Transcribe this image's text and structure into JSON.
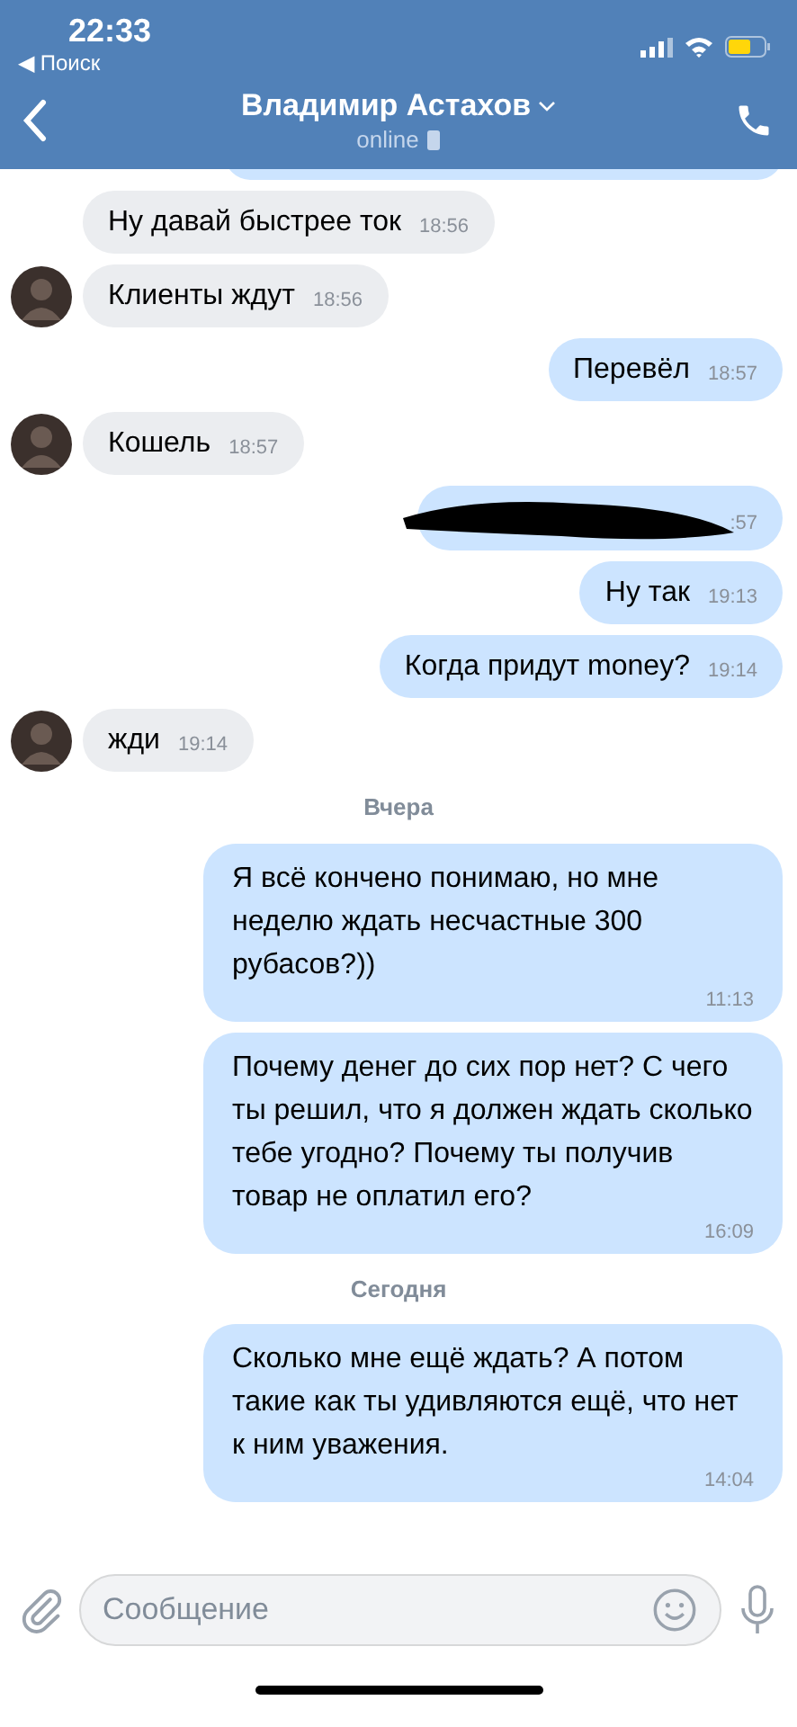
{
  "status_bar": {
    "time": "22:33",
    "back_label": "◀ Поиск"
  },
  "header": {
    "title": "Владимир Астахов",
    "status": "online"
  },
  "messages": [
    {
      "kind": "incoming",
      "avatar": false,
      "text": "Ну давай быстрее ток",
      "time": "18:56"
    },
    {
      "kind": "incoming",
      "avatar": true,
      "text": "Клиенты ждут",
      "time": "18:56"
    },
    {
      "kind": "outgoing",
      "text": "Перевёл",
      "time": "18:57"
    },
    {
      "kind": "incoming",
      "avatar": true,
      "text": "Кошель",
      "time": "18:57"
    },
    {
      "kind": "redacted",
      "time": ":57"
    },
    {
      "kind": "outgoing",
      "text": "Ну так",
      "time": "19:13"
    },
    {
      "kind": "outgoing",
      "text": "Когда придут money?",
      "time": "19:14"
    },
    {
      "kind": "incoming",
      "avatar": true,
      "text": "жди",
      "time": "19:14"
    },
    {
      "kind": "date",
      "text": "Вчера"
    },
    {
      "kind": "long",
      "text": "Я всё кончено понимаю, но мне неделю ждать несчастные 300 рубасов?))",
      "time": "11:13"
    },
    {
      "kind": "long",
      "text": "Почему денег до сих пор нет? С чего ты решил, что я должен ждать сколько тебе угодно? Почему ты получив товар не оплатил его?",
      "time": "16:09"
    },
    {
      "kind": "date",
      "text": "Сегодня"
    },
    {
      "kind": "long",
      "text": "Сколько мне ещё ждать? А потом такие как ты удивляются ещё, что нет к ним уважения.",
      "time": "14:04"
    }
  ],
  "composer": {
    "placeholder": "Сообщение"
  }
}
